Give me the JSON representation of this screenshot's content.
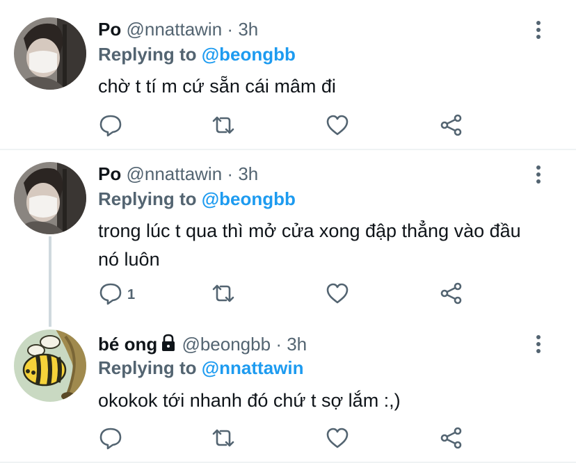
{
  "tweets": [
    {
      "display_name": "Po",
      "handle": "@nnattawin",
      "separator": "·",
      "time": "3h",
      "replying_prefix": "Replying to",
      "replying_to": "@beongbb",
      "text": "chờ t tí m cứ sẵn cái mâm đi",
      "reply_count": "",
      "avatar": "person-masked-avatar"
    },
    {
      "display_name": "Po",
      "handle": "@nnattawin",
      "separator": "·",
      "time": "3h",
      "replying_prefix": "Replying to",
      "replying_to": "@beongbb",
      "text": "trong lúc t qua thì mở cửa xong đập thẳng vào đầu nó luôn",
      "reply_count": "1",
      "avatar": "person-masked-avatar"
    },
    {
      "display_name": "bé ong",
      "handle": "@beongbb",
      "separator": "·",
      "time": "3h",
      "replying_prefix": "Replying to",
      "replying_to": "@nnattawin",
      "text": "okokok tới nhanh đó chứ t sợ lắm :,)",
      "reply_count": "",
      "avatar": "bee-avatar",
      "protected": true
    }
  ],
  "colors": {
    "accent": "#1d9bf0",
    "secondary_text": "#536471",
    "primary_text": "#0f1419",
    "divider": "#eff3f4"
  },
  "icons": [
    "more-icon",
    "reply-icon",
    "retweet-icon",
    "like-icon",
    "share-icon",
    "lock-icon"
  ]
}
